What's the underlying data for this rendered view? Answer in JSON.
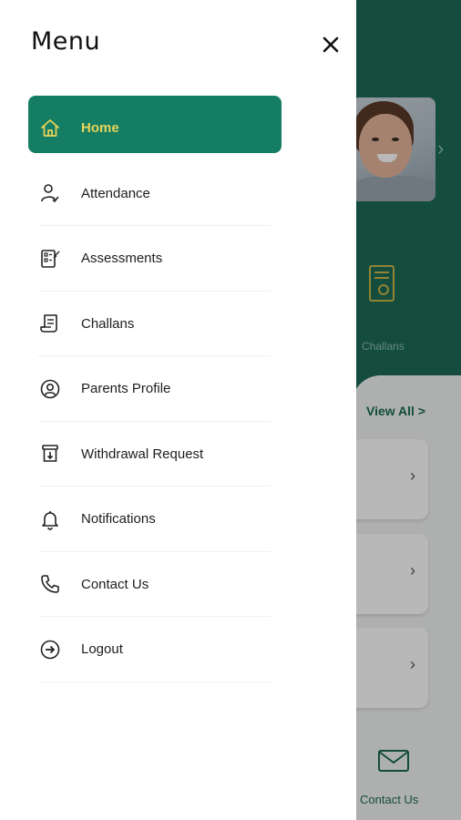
{
  "drawer": {
    "title": "Menu",
    "close_icon": "close-icon",
    "items": [
      {
        "label": "Home",
        "icon": "home-icon",
        "active": true
      },
      {
        "label": "Attendance",
        "icon": "user-check-icon",
        "active": false
      },
      {
        "label": "Assessments",
        "icon": "clipboard-edit-icon",
        "active": false
      },
      {
        "label": "Challans",
        "icon": "receipt-icon",
        "active": false
      },
      {
        "label": "Parents Profile",
        "icon": "user-circle-icon",
        "active": false
      },
      {
        "label": "Withdrawal Request",
        "icon": "withdraw-icon",
        "active": false
      },
      {
        "label": "Notifications",
        "icon": "bell-icon",
        "active": false
      },
      {
        "label": "Contact Us",
        "icon": "phone-icon",
        "active": false
      },
      {
        "label": "Logout",
        "icon": "logout-icon",
        "active": false
      }
    ]
  },
  "background": {
    "challans_label": "Challans",
    "view_all_label": "View All  >",
    "contact_label": "Contact Us"
  },
  "colors": {
    "accent": "#147d63",
    "active_text": "#e6d35a",
    "background_green": "#1c6a55"
  }
}
